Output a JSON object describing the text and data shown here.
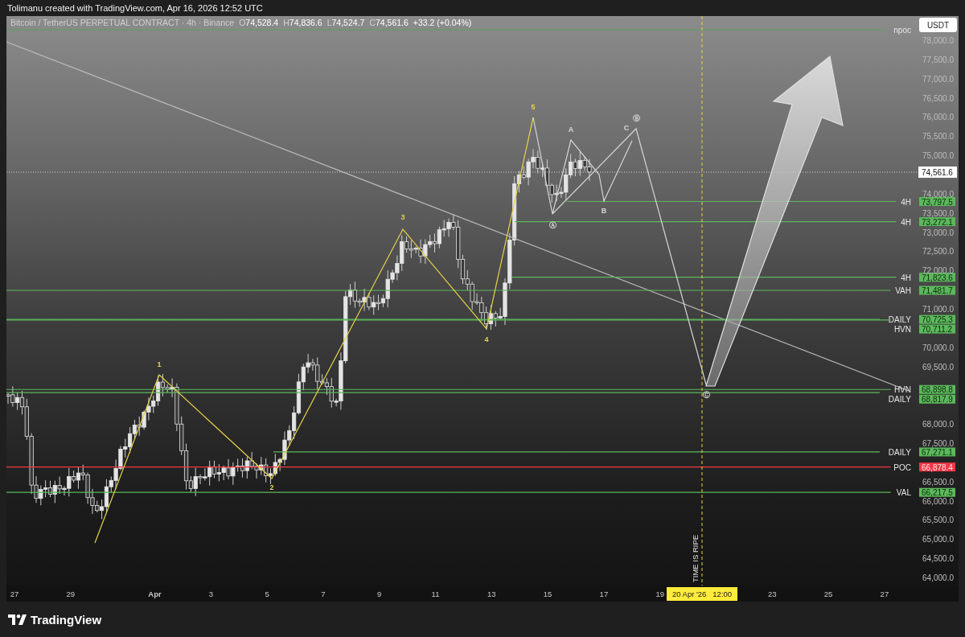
{
  "header": {
    "text": "Tolimanu created with TradingView.com, Apr 16, 2026 12:52 UTC"
  },
  "legend": {
    "symbol": "Bitcoin / TetherUS PERPETUAL CONTRACT · 4h · Binance",
    "ohlc": [
      {
        "label": "O",
        "value": "74,528.4"
      },
      {
        "label": "H",
        "value": "74,836.6"
      },
      {
        "label": "L",
        "value": "74,524.7"
      },
      {
        "label": "C",
        "value": "74,561.6"
      }
    ],
    "change": "+33.2 (+0.04%)"
  },
  "currency_button": "USDT",
  "price_axis": {
    "ticks": [
      "78,000.0",
      "77,500.0",
      "77,000.0",
      "76,500.0",
      "76,000.0",
      "75,500.0",
      "75,000.0",
      "74,000.0",
      "73,500.0",
      "73,000.0",
      "72,500.0",
      "72,000.0",
      "71,000.0",
      "70,000.0",
      "69,500.0",
      "68,000.0",
      "67,500.0",
      "66,500.0",
      "66,000.0",
      "65,500.0",
      "65,000.0",
      "64,500.0",
      "64,000.0"
    ],
    "last_price": "74,561.6"
  },
  "levels": [
    {
      "label": "npoc"
    },
    {
      "label": "4H",
      "price": "73,797.5",
      "color": "#5cb85c"
    },
    {
      "label": "4H",
      "price": "73,272.1",
      "color": "#5cb85c"
    },
    {
      "label": "4H",
      "price": "71,823.6",
      "color": "#5cb85c"
    },
    {
      "label": "VAH",
      "price": "71,481.7",
      "color": "#5cb85c"
    },
    {
      "label": "DAILY",
      "price": "70,725.3",
      "color": "#5cb85c"
    },
    {
      "label": "HVN",
      "price": "70,711.2",
      "color": "#5cb85c"
    },
    {
      "label": "HVN",
      "price": "68,898.8",
      "color": "#5cb85c"
    },
    {
      "label": "DAILY",
      "price": "68,817.9",
      "color": "#5cb85c"
    },
    {
      "label": "DAILY",
      "price": "67,271.1",
      "color": "#5cb85c"
    },
    {
      "label": "POC",
      "price": "66,878.4",
      "color": "#f23645"
    },
    {
      "label": "VAL",
      "price": "66,217.5",
      "color": "#5cb85c"
    }
  ],
  "wave_labels": [
    {
      "text": "1",
      "kind": "impulse"
    },
    {
      "text": "2",
      "kind": "impulse"
    },
    {
      "text": "3",
      "kind": "impulse"
    },
    {
      "text": "4",
      "kind": "impulse"
    },
    {
      "text": "5",
      "kind": "impulse"
    },
    {
      "text": "A",
      "kind": "corrective"
    },
    {
      "text": "B",
      "kind": "corrective"
    },
    {
      "text": "C",
      "kind": "corrective"
    },
    {
      "text": "Ⓐ",
      "kind": "corrective"
    },
    {
      "text": "Ⓑ",
      "kind": "corrective"
    },
    {
      "text": "Ⓒ",
      "kind": "corrective"
    }
  ],
  "time_note": "TIME IS RIPE",
  "time_axis": {
    "ticks": [
      {
        "label": "27",
        "kind": "day"
      },
      {
        "label": "29",
        "kind": "day"
      },
      {
        "label": "Apr",
        "kind": "month"
      },
      {
        "label": "3",
        "kind": "day"
      },
      {
        "label": "5",
        "kind": "day"
      },
      {
        "label": "7",
        "kind": "day"
      },
      {
        "label": "9",
        "kind": "day"
      },
      {
        "label": "11",
        "kind": "day"
      },
      {
        "label": "13",
        "kind": "day"
      },
      {
        "label": "15",
        "kind": "day"
      },
      {
        "label": "17",
        "kind": "day"
      },
      {
        "label": "19",
        "kind": "day"
      },
      {
        "label": "23",
        "kind": "day"
      },
      {
        "label": "25",
        "kind": "day"
      },
      {
        "label": "27",
        "kind": "day"
      }
    ],
    "marker": "20 Apr '26   12:00"
  },
  "logo": "TradingView"
}
